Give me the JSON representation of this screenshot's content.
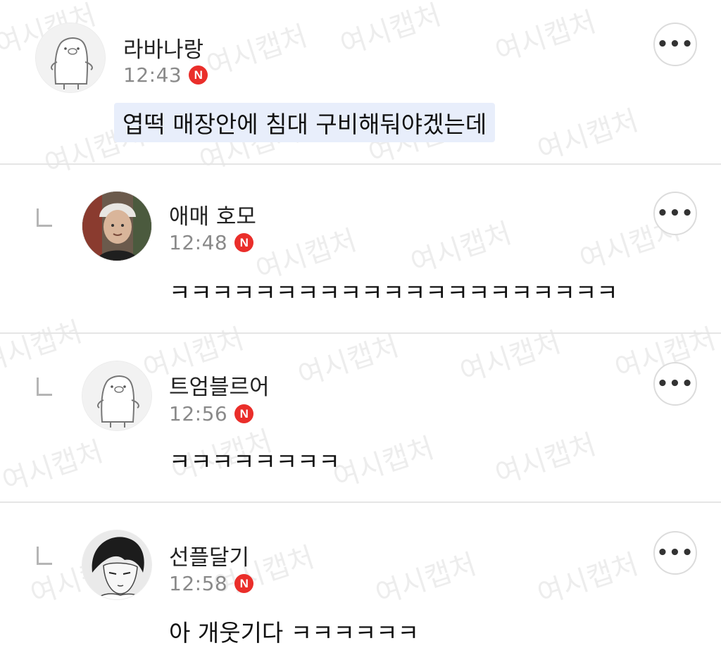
{
  "watermark_text": "여시캡처",
  "new_badge_label": "N",
  "more_icon": "•••",
  "comments": [
    {
      "author": "라바나랑",
      "time": "12:43",
      "text": "엽떡 매장안에 침대 구비해둬야겠는데",
      "avatar": "pig-default-avatar"
    },
    {
      "author": "애매 호모",
      "time": "12:48",
      "text": "ㅋㅋㅋㅋㅋㅋㅋㅋㅋㅋㅋㅋㅋㅋㅋㅋㅋㅋㅋㅋㅋ",
      "avatar": "photo-person-beanie"
    },
    {
      "author": "트엄블르어",
      "time": "12:56",
      "text": "ㅋㅋㅋㅋㅋㅋㅋㅋ",
      "avatar": "pig-default-avatar"
    },
    {
      "author": "선플달기",
      "time": "12:58",
      "text": "아 개웃기다 ㅋㅋㅋㅋㅋㅋ",
      "avatar": "manga-character-avatar"
    }
  ],
  "colors": {
    "badge": "#ea2e2a",
    "highlight": "#e8eefb",
    "divider": "#e5e5e5",
    "time": "#8a8a8a"
  }
}
